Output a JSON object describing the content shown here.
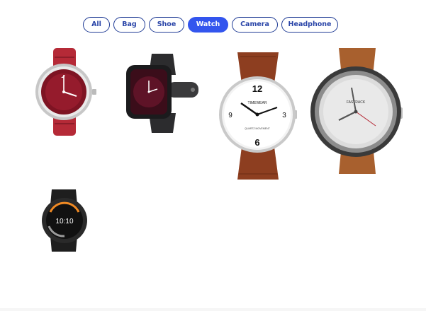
{
  "filters": {
    "items": [
      {
        "label": "All"
      },
      {
        "label": "Bag"
      },
      {
        "label": "Shoe"
      },
      {
        "label": "Watch"
      },
      {
        "label": "Camera"
      },
      {
        "label": "Headphone"
      }
    ],
    "active": "Watch"
  },
  "products": [
    {
      "name": "red-dial-watch-image",
      "dial_brand": "",
      "colors": {
        "strap": "#b52a37",
        "dial": "#7e1423"
      }
    },
    {
      "name": "black-smartwatch-image",
      "dial_brand": "",
      "colors": {
        "strap": "#2c2c2e",
        "dial": "#3b0d1a"
      }
    },
    {
      "name": "white-dial-watch-image",
      "dial_brand": "TIMEWEAR",
      "dial_sub": "QUARTZ MOVEMENT",
      "colors": {
        "strap": "#8d3e20",
        "dial": "#ffffff"
      }
    },
    {
      "name": "silver-dial-watch-image",
      "dial_brand": "FASTRACK",
      "colors": {
        "strap": "#a8602e",
        "dial": "#dcdcdc"
      }
    },
    {
      "name": "round-smartwatch-image",
      "dial_time": "10:10",
      "colors": {
        "strap": "#1e1e1e",
        "dial": "#1a1a1a"
      }
    }
  ]
}
